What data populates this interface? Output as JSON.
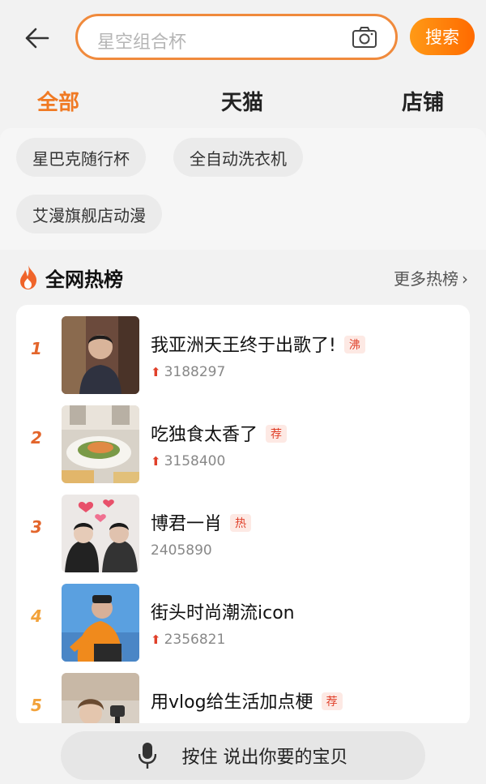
{
  "search": {
    "placeholder": "星空组合杯",
    "button_label": "搜索"
  },
  "tabs": [
    {
      "label": "全部",
      "active": true
    },
    {
      "label": "天猫",
      "active": false
    },
    {
      "label": "店铺",
      "active": false
    }
  ],
  "history_chips": [
    "星巴克随行杯",
    "全自动洗衣机",
    "艾漫旗舰店动漫"
  ],
  "hot_list": {
    "title": "全网热榜",
    "more_label": "更多热榜",
    "items": [
      {
        "rank": "1",
        "title": "我亚洲天王终于出歌了!",
        "badge": "沸",
        "count": "3188297",
        "trend": "up"
      },
      {
        "rank": "2",
        "title": "吃独食太香了",
        "badge": "荐",
        "count": "3158400",
        "trend": "up"
      },
      {
        "rank": "3",
        "title": "博君一肖",
        "badge": "热",
        "count": "2405890",
        "trend": "none"
      },
      {
        "rank": "4",
        "title": "街头时尚潮流icon",
        "badge": "",
        "count": "2356821",
        "trend": "up"
      },
      {
        "rank": "5",
        "title": "用vlog给生活加点梗",
        "badge": "荐",
        "count": "",
        "trend": "up"
      }
    ]
  },
  "voice": {
    "label": "按住 说出你要的宝贝"
  },
  "colors": {
    "accent": "#f07a24",
    "badge_red": "#e0402a"
  }
}
